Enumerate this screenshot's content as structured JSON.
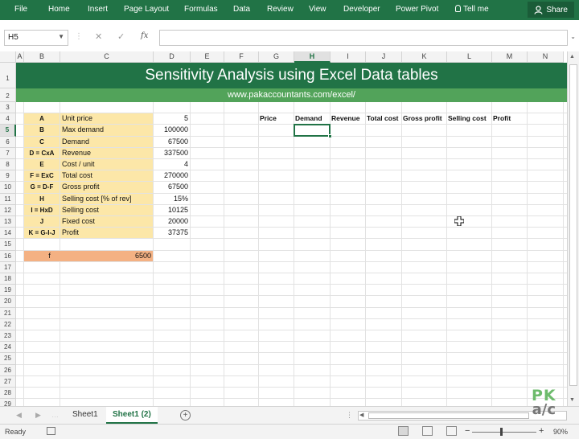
{
  "ribbon": {
    "tabs": [
      "File",
      "Home",
      "Insert",
      "Page Layout",
      "Formulas",
      "Data",
      "Review",
      "View",
      "Developer",
      "Power Pivot"
    ],
    "tell_me": "Tell me",
    "share": "Share"
  },
  "formula_bar": {
    "name_box": "H5",
    "fx": "fx",
    "formula": ""
  },
  "columns": [
    "A",
    "B",
    "C",
    "D",
    "E",
    "F",
    "G",
    "H",
    "I",
    "J",
    "K",
    "L",
    "M",
    "N"
  ],
  "selected_column": "H",
  "selected_row": 5,
  "rows": [
    "1",
    "2",
    "3",
    "4",
    "5",
    "6",
    "7",
    "8",
    "9",
    "10",
    "11",
    "12",
    "13",
    "14",
    "15",
    "16",
    "17",
    "18",
    "19",
    "20",
    "21",
    "22",
    "23",
    "24",
    "25",
    "26",
    "27",
    "28",
    "29"
  ],
  "sheet": {
    "title": "Sensitivity Analysis using Excel Data tables",
    "url": "www.pakaccountants.com/excel/",
    "inputs": [
      {
        "code": "A",
        "label": "Unit price",
        "value": "5"
      },
      {
        "code": "B",
        "label": "Max demand",
        "value": "100000"
      },
      {
        "code": "C",
        "label": "Demand",
        "value": "67500"
      },
      {
        "code": "D = CxA",
        "label": "Revenue",
        "value": "337500"
      },
      {
        "code": "E",
        "label": "Cost / unit",
        "value": "4"
      },
      {
        "code": "F = ExC",
        "label": "Total cost",
        "value": "270000"
      },
      {
        "code": "G = D-F",
        "label": "Gross profit",
        "value": "67500"
      },
      {
        "code": "H",
        "label": "Selling cost [% of rev]",
        "value": "15%"
      },
      {
        "code": "I = HxD",
        "label": "Selling cost",
        "value": "10125"
      },
      {
        "code": "J",
        "label": "Fixed cost",
        "value": "20000"
      },
      {
        "code": "K = G-I-J",
        "label": "Profit",
        "value": "37375"
      }
    ],
    "f_label": "f",
    "f_value": "6500",
    "table_headers": [
      "Price",
      "Demand",
      "Revenue",
      "Total cost",
      "Gross profit",
      "Selling cost",
      "Profit"
    ]
  },
  "sheet_tabs": [
    "Sheet1",
    "Sheet1 (2)"
  ],
  "active_sheet": "Sheet1 (2)",
  "status": {
    "ready": "Ready",
    "zoom": "90%"
  },
  "logo": {
    "line1": "PK",
    "line2": "a/c"
  },
  "colors": {
    "excel_green": "#217346",
    "band_green": "#52a35a",
    "input_yellow": "#fce7a8",
    "orange": "#f4b183"
  }
}
